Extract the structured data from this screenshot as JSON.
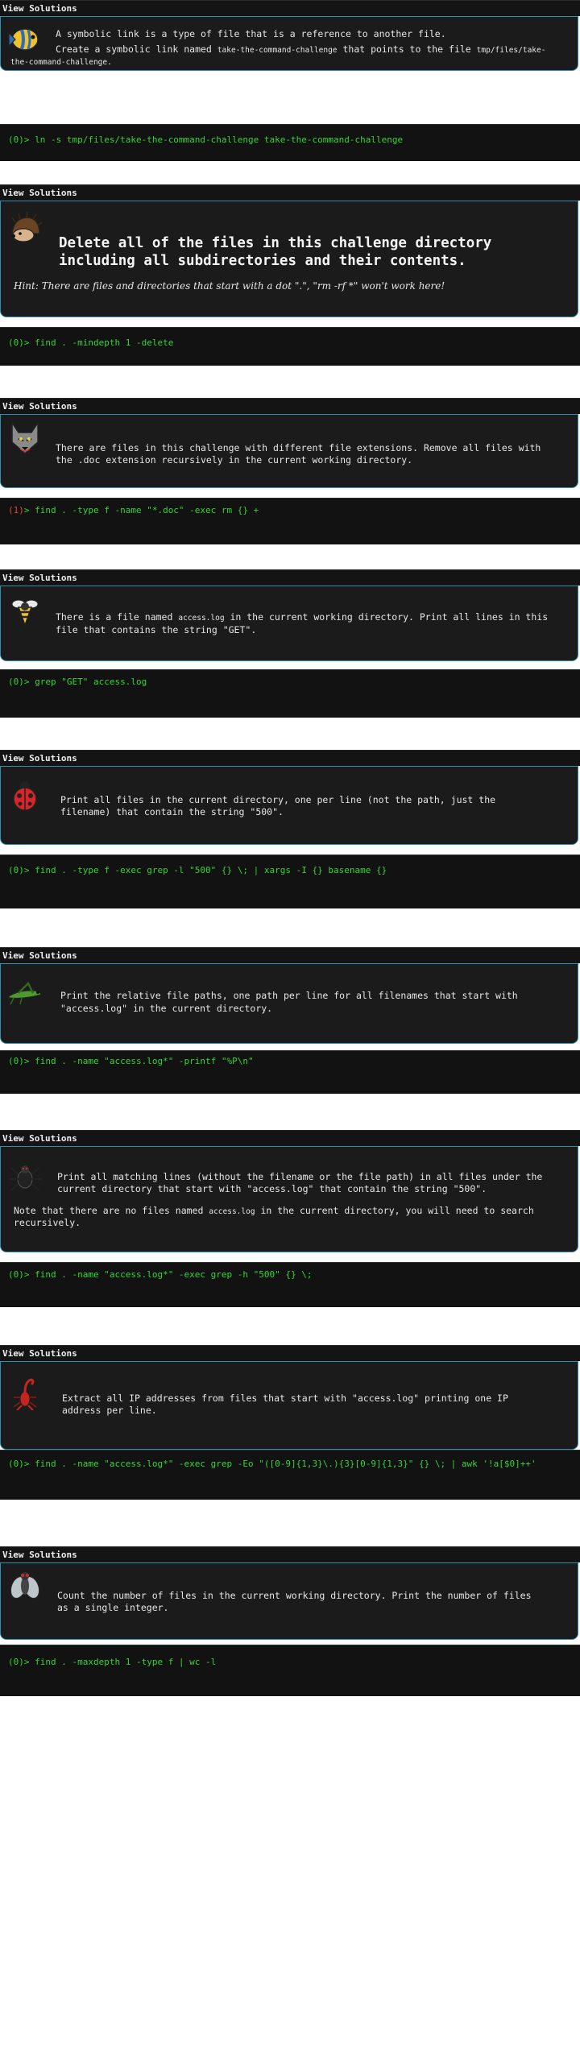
{
  "header_label": "View Solutions",
  "prompt_prefix": ">",
  "challenges": [
    {
      "icon": "fish-icon",
      "description_prefix": "A symbolic link is a type of file that is a reference to another file.",
      "description_line2a": "Create a symbolic link named",
      "description_code1": "take-the-command-challenge",
      "description_line2b": "that points to the file",
      "description_code2a": "tmp/files/take-",
      "description_code2b": "the-command-challenge.",
      "status": "(0)",
      "command": "ln -s tmp/files/take-the-command-challenge take-the-command-challenge"
    },
    {
      "icon": "hedgehog-icon",
      "description_line1": "Delete all of the files in this challenge directory",
      "description_line2": "including all subdirectories and their contents.",
      "hint": "Hint: There are files and directories that start with a dot \".\", \"rm -rf *\" won't work here!",
      "status": "(0)",
      "command": "find . -mindepth 1 -delete"
    },
    {
      "icon": "wolf-icon",
      "description_line1": "There are files in this challenge with different file extensions. Remove all files with",
      "description_line2": "the .doc extension recursively in the current working directory.",
      "status": "(1)",
      "command": "find . -type f -name \"*.doc\" -exec rm {} +"
    },
    {
      "icon": "bee-icon",
      "description_line1a": "There is a file named",
      "description_code": "access.log",
      "description_line1b": "in the current working directory. Print all lines in this",
      "description_line2": "file that contains the string \"GET\".",
      "status": "(0)",
      "command": "grep \"GET\" access.log"
    },
    {
      "icon": "ladybug-icon",
      "description_line1": "Print all files in the current directory, one per line (not the path, just the",
      "description_line2": "filename) that contain the string \"500\".",
      "status": "(0)",
      "command": "find . -type f -exec grep -l \"500\" {} \\; | xargs -I {} basename {}"
    },
    {
      "icon": "grasshopper-icon",
      "description_line1": "Print the relative file paths, one path per line for all filenames that start with",
      "description_line2": "\"access.log\" in the current directory.",
      "status": "(0)",
      "command": "find . -name \"access.log*\" -printf \"%P\\n\""
    },
    {
      "icon": "spider-icon",
      "description_line1": "Print all matching lines (without the filename or the file path) in all files under the",
      "description_line2": "current directory that start with \"access.log\" that contain the string \"500\".",
      "note_line1a": "Note that there are no files named",
      "note_code": "access.log",
      "note_line1b": "in the current directory, you will need to search",
      "note_line2": "recursively.",
      "status": "(0)",
      "command": "find . -name \"access.log*\" -exec grep -h \"500\" {} \\;"
    },
    {
      "icon": "scorpion-icon",
      "description_line1": "Extract all IP addresses from files that start with \"access.log\" printing one IP",
      "description_line2": "address per line.",
      "status": "(0)",
      "command": "find . -name \"access.log*\" -exec grep -Eo \"([0-9]{1,3}\\.){3}[0-9]{1,3}\" {} \\; | awk '!a[$0]++'"
    },
    {
      "icon": "fly-icon",
      "description_line1": "Count the number of files in the current working directory. Print the number of files",
      "description_line2": "as a single integer.",
      "status": "(0)",
      "command": "find . -maxdepth 1 -type f | wc -l"
    }
  ]
}
